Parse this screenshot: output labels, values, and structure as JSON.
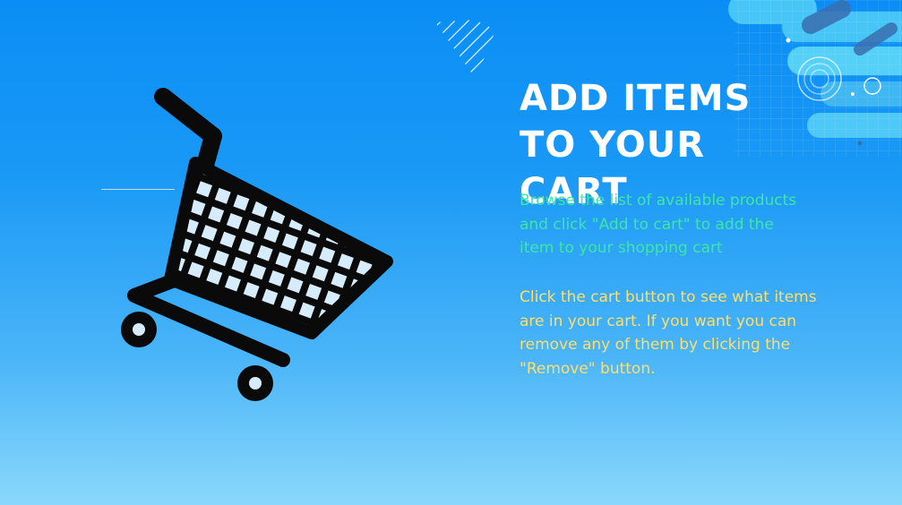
{
  "slide": {
    "title": "Add Items to Your Cart",
    "paragraph_1": "Browse the list of available products\nand click \"Add to cart\" to add the\nitem to your shopping cart",
    "paragraph_2": "Click the cart button to see what items\nare in your cart. If you want you can\nremove any of them by clicking the\n\"Remove\" button."
  },
  "colors": {
    "title": "#ffffff",
    "paragraph_1": "#3ee7a6",
    "paragraph_2": "#ffde6a"
  },
  "icons": {
    "main": "shopping-cart-icon"
  }
}
